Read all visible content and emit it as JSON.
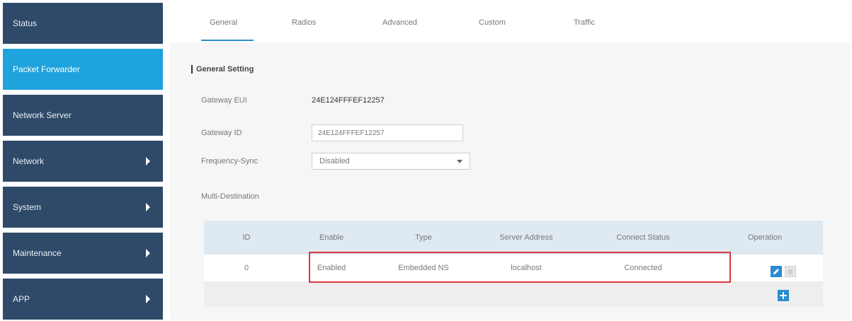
{
  "sidebar": {
    "items": [
      {
        "label": "Status",
        "has_arrow": false
      },
      {
        "label": "Packet Forwarder",
        "has_arrow": false,
        "active": true
      },
      {
        "label": "Network Server",
        "has_arrow": false
      },
      {
        "label": "Network",
        "has_arrow": true
      },
      {
        "label": "System",
        "has_arrow": true
      },
      {
        "label": "Maintenance",
        "has_arrow": true
      },
      {
        "label": "APP",
        "has_arrow": true
      }
    ]
  },
  "tabs": [
    {
      "label": "General",
      "active": true
    },
    {
      "label": "Radios"
    },
    {
      "label": "Advanced"
    },
    {
      "label": "Custom"
    },
    {
      "label": "Traffic"
    }
  ],
  "general": {
    "section_title": "General Setting",
    "gateway_eui_label": "Gateway EUI",
    "gateway_eui_value": "24E124FFFEF12257",
    "gateway_id_label": "Gateway ID",
    "gateway_id_value": "24E124FFFEF12257",
    "frequency_sync_label": "Frequency-Sync",
    "frequency_sync_value": "Disabled",
    "multi_destination_label": "Multi-Destination"
  },
  "table": {
    "headers": [
      "ID",
      "Enable",
      "Type",
      "Server Address",
      "Connect Status",
      "Operation"
    ],
    "rows": [
      [
        "0",
        "Enabled",
        "Embedded NS",
        "localhost",
        "Connected"
      ]
    ]
  },
  "colors": {
    "sidebar_bg": "#2f4a69",
    "sidebar_active": "#1fa3dc",
    "accent": "#2a8ccf",
    "highlight_border": "#d9363e",
    "table_header_bg": "#dfe9f2"
  },
  "icons": {
    "edit": "edit-icon",
    "delete": "delete-icon",
    "add": "plus-icon",
    "submenu": "chevron-right-icon"
  }
}
